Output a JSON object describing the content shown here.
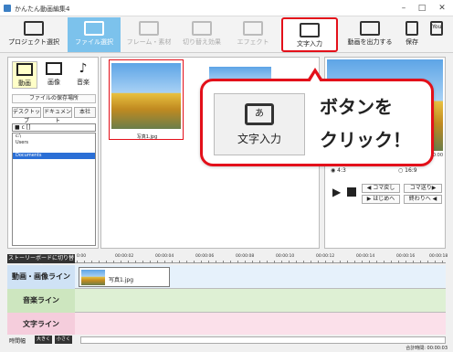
{
  "window": {
    "title": "かんたん動画編集4",
    "minimize": "–",
    "maximize": "□",
    "close": "✕"
  },
  "toolbar": {
    "project": "プロジェクト選択",
    "file": "ファイル選択",
    "frame": "フレーム・素材",
    "transition": "切り替え効果",
    "effect": "エフェクト",
    "text_input": "文字入力",
    "export": "動画を出力する",
    "save": "保存",
    "youtube": "You"
  },
  "media": {
    "tabs": [
      "動画",
      "画像",
      "音楽"
    ],
    "location_title": "ファイルの保存場所",
    "locations": [
      "デスクトップ",
      "ドキュメント",
      "本社"
    ],
    "drive": "■ c [] ",
    "tree": [
      "c:\\",
      "Users",
      "",
      "Documents"
    ]
  },
  "thumbs": {
    "caption": "写真1.jpg"
  },
  "preview": {
    "time": "0:00",
    "ratio_a": "◉ 4:3",
    "ratio_b": "○ 16:9",
    "btn_prev_frame": "◀ コマ戻し",
    "btn_next_frame": "コマ送り▶",
    "btn_start": "▶ はじめへ",
    "btn_end": "終わりへ ◀"
  },
  "callout": {
    "button_label": "文字入力",
    "button_glyph": "あ",
    "line1": "ボタンを",
    "line2": "クリック！"
  },
  "timeline": {
    "switch_label": "ストーリーボードに切り替え",
    "ticks": [
      "0:00",
      "00:00:02",
      "00:00:04",
      "00:00:06",
      "00:00:08",
      "00:00:10",
      "00:00:12",
      "00:00:14",
      "00:00:16",
      "00:00:18"
    ],
    "tracks": [
      "動画・画像ライン",
      "音楽ライン",
      "文字ライン"
    ],
    "clip_label": "写真1.jpg"
  },
  "status": {
    "zoom_label": "時間幅",
    "zoom_in": "大きく",
    "zoom_out": "小さく",
    "duration": "合計時間: 00:00:03"
  },
  "colors": {
    "accent": "#e3101a",
    "active_tab": "#7cc2ec",
    "track_video": "#e6f1fb",
    "track_music": "#def0d4",
    "track_text": "#fbe0ea"
  }
}
